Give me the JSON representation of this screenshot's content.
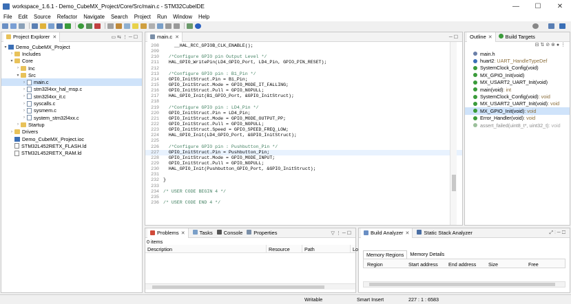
{
  "window": {
    "title": "workspace_1.6.1 - Demo_CubeMX_Project/Core/Src/main.c - STM32CubeIDE",
    "minimize": "—",
    "maximize": "☐",
    "close": "✕"
  },
  "menu": [
    "File",
    "Edit",
    "Source",
    "Refactor",
    "Navigate",
    "Search",
    "Project",
    "Run",
    "Window",
    "Help"
  ],
  "project_explorer": {
    "tab": "Project Explorer",
    "tree": [
      {
        "label": "Demo_CubeMX_Project",
        "level": 0,
        "icon": "project",
        "arrow": "▾"
      },
      {
        "label": "Includes",
        "level": 1,
        "icon": "folder",
        "arrow": "›"
      },
      {
        "label": "Core",
        "level": 1,
        "icon": "folder",
        "arrow": "▾"
      },
      {
        "label": "Inc",
        "level": 2,
        "icon": "folder",
        "arrow": "›"
      },
      {
        "label": "Src",
        "level": 2,
        "icon": "folder",
        "arrow": "▾"
      },
      {
        "label": "main.c",
        "level": 3,
        "icon": "cfile",
        "arrow": "›",
        "selected": true
      },
      {
        "label": "stm32l4xx_hal_msp.c",
        "level": 3,
        "icon": "cfile",
        "arrow": "›"
      },
      {
        "label": "stm32l4xx_it.c",
        "level": 3,
        "icon": "cfile",
        "arrow": "›"
      },
      {
        "label": "syscalls.c",
        "level": 3,
        "icon": "cfile",
        "arrow": "›"
      },
      {
        "label": "sysmem.c",
        "level": 3,
        "icon": "cfile",
        "arrow": "›"
      },
      {
        "label": "system_stm32l4xx.c",
        "level": 3,
        "icon": "cfile",
        "arrow": "›"
      },
      {
        "label": "Startup",
        "level": 2,
        "icon": "folder",
        "arrow": "›"
      },
      {
        "label": "Drivers",
        "level": 1,
        "icon": "folder",
        "arrow": "›"
      },
      {
        "label": "Demo_CubeMX_Project.ioc",
        "level": 1,
        "icon": "ioc",
        "arrow": ""
      },
      {
        "label": "STM32L452RETX_FLASH.ld",
        "level": 1,
        "icon": "ld",
        "arrow": ""
      },
      {
        "label": "STM32L452RETX_RAM.ld",
        "level": 1,
        "icon": "ld",
        "arrow": ""
      }
    ]
  },
  "editor": {
    "tab": "main.c",
    "lines": [
      {
        "n": "208",
        "t": "    __HAL_RCC_GPIOB_CLK_ENABLE();",
        "c": "plain"
      },
      {
        "n": "209",
        "t": "",
        "c": "plain"
      },
      {
        "n": "210",
        "t": "  /*Configure GPIO pin Output Level */",
        "c": "cmt"
      },
      {
        "n": "211",
        "t": "  HAL_GPIO_WritePin(LD4_GPIO_Port, LD4_Pin, GPIO_PIN_RESET);",
        "c": "plain"
      },
      {
        "n": "212",
        "t": "",
        "c": "plain"
      },
      {
        "n": "213",
        "t": "  /*Configure GPIO pin : B1_Pin */",
        "c": "cmt"
      },
      {
        "n": "214",
        "t": "  GPIO_InitStruct.Pin = B1_Pin;",
        "c": "plain"
      },
      {
        "n": "215",
        "t": "  GPIO_InitStruct.Mode = GPIO_MODE_IT_FALLING;",
        "c": "plain"
      },
      {
        "n": "216",
        "t": "  GPIO_InitStruct.Pull = GPIO_NOPULL;",
        "c": "plain"
      },
      {
        "n": "217",
        "t": "  HAL_GPIO_Init(B1_GPIO_Port, &GPIO_InitStruct);",
        "c": "plain"
      },
      {
        "n": "218",
        "t": "",
        "c": "plain"
      },
      {
        "n": "219",
        "t": "  /*Configure GPIO pin : LD4_Pin */",
        "c": "cmt"
      },
      {
        "n": "220",
        "t": "  GPIO_InitStruct.Pin = LD4_Pin;",
        "c": "plain"
      },
      {
        "n": "221",
        "t": "  GPIO_InitStruct.Mode = GPIO_MODE_OUTPUT_PP;",
        "c": "plain"
      },
      {
        "n": "222",
        "t": "  GPIO_InitStruct.Pull = GPIO_NOPULL;",
        "c": "plain"
      },
      {
        "n": "223",
        "t": "  GPIO_InitStruct.Speed = GPIO_SPEED_FREQ_LOW;",
        "c": "plain"
      },
      {
        "n": "224",
        "t": "  HAL_GPIO_Init(LD4_GPIO_Port, &GPIO_InitStruct);",
        "c": "plain"
      },
      {
        "n": "225",
        "t": "",
        "c": "plain"
      },
      {
        "n": "226",
        "t": "  /*Configure GPIO pin : Pushbutton_Pin */",
        "c": "cmt"
      },
      {
        "n": "227",
        "t": "  GPIO_InitStruct.Pin = Pushbutton_Pin;",
        "c": "plain",
        "hl": true
      },
      {
        "n": "228",
        "t": "  GPIO_InitStruct.Mode = GPIO_MODE_INPUT;",
        "c": "plain"
      },
      {
        "n": "229",
        "t": "  GPIO_InitStruct.Pull = GPIO_NOPULL;",
        "c": "plain"
      },
      {
        "n": "230",
        "t": "  HAL_GPIO_Init(Pushbutton_GPIO_Port, &GPIO_InitStruct);",
        "c": "plain"
      },
      {
        "n": "231",
        "t": "",
        "c": "plain"
      },
      {
        "n": "232",
        "t": "}",
        "c": "plain"
      },
      {
        "n": "233",
        "t": "",
        "c": "plain"
      },
      {
        "n": "234",
        "t": "/* USER CODE BEGIN 4 */",
        "c": "cmt"
      },
      {
        "n": "235",
        "t": "",
        "c": "plain"
      },
      {
        "n": "236",
        "t": "/* USER CODE END 4 */",
        "c": "cmt"
      }
    ]
  },
  "outline": {
    "tabs": [
      "Outline",
      "Build Targets"
    ],
    "items": [
      {
        "label": "main.h",
        "type": "",
        "color": "#6b7fa8"
      },
      {
        "label": "huart2",
        "type": " : UART_HandleTypeDef",
        "color": "#3b6fb6"
      },
      {
        "label": "SystemClock_Config(void)",
        "type": "",
        "color": "#3a9b3a"
      },
      {
        "label": "MX_GPIO_Init(void)",
        "type": "",
        "color": "#3a9b3a"
      },
      {
        "label": "MX_USART2_UART_Init(void)",
        "type": "",
        "color": "#3a9b3a"
      },
      {
        "label": "main(void)",
        "type": " : int",
        "color": "#3a9b3a"
      },
      {
        "label": "SystemClock_Config(void)",
        "type": " : void",
        "color": "#3a9b3a"
      },
      {
        "label": "MX_USART2_UART_Init(void)",
        "type": " : void",
        "color": "#3a9b3a"
      },
      {
        "label": "MX_GPIO_Init(void)",
        "type": " : void",
        "color": "#3a9b3a",
        "selected": true
      },
      {
        "label": "Error_Handler(void)",
        "type": " : void",
        "color": "#3a9b3a"
      },
      {
        "label": "assert_failed(uint8_t*, uint32_t)",
        "type": " : void",
        "color": "#9bbf9b",
        "dim": true
      }
    ]
  },
  "problems": {
    "tabs": [
      "Problems",
      "Tasks",
      "Console",
      "Properties"
    ],
    "count": "0 items",
    "columns": [
      "Description",
      "Resource",
      "Path",
      "Lo"
    ]
  },
  "build_analyzer": {
    "tabs": [
      "Build Analyzer",
      "Static Stack Analyzer"
    ],
    "subtabs": [
      "Memory Regions",
      "Memory Details"
    ],
    "columns": [
      "Region",
      "Start address",
      "End address",
      "Size",
      "Free"
    ]
  },
  "status": {
    "writable": "Writable",
    "insert": "Smart Insert",
    "position": "227 : 1 : 6583"
  },
  "colors": {
    "accent": "#3b6fb6",
    "selection": "#cfe3fa"
  }
}
